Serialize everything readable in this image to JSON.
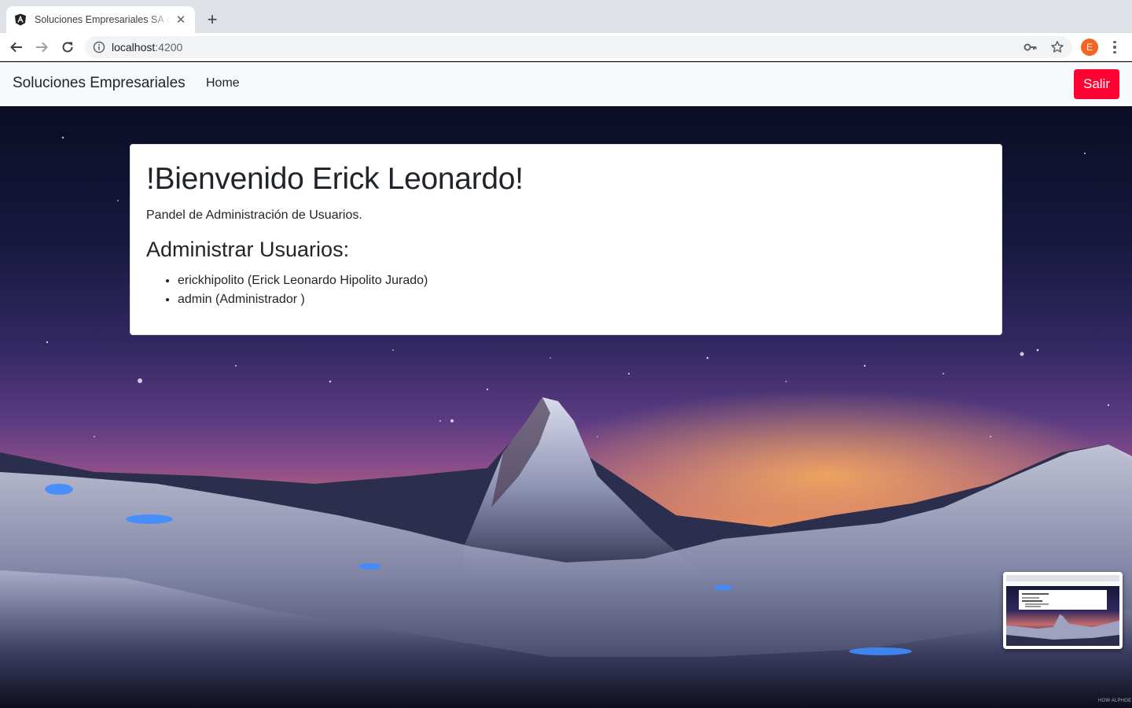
{
  "browser": {
    "tab_title": "Soluciones Empresariales SA de CV",
    "url_host": "localhost",
    "url_port": ":4200",
    "profile_initial": "E",
    "profile_color": "#f26522"
  },
  "navbar": {
    "brand": "Soluciones Empresariales",
    "home_link": "Home",
    "logout_button": "Salir",
    "logout_color": "#ff0033"
  },
  "card": {
    "title": "!Bienvenido Erick Leonardo!",
    "subtitle": "Pandel de Administración de Usuarios.",
    "section_heading": "Administrar Usuarios:",
    "users": [
      "erickhipolito (Erick Leonardo Hipolito Jurado)",
      "admin (Administrador )"
    ]
  },
  "watermark": "HOW ALPHOE"
}
